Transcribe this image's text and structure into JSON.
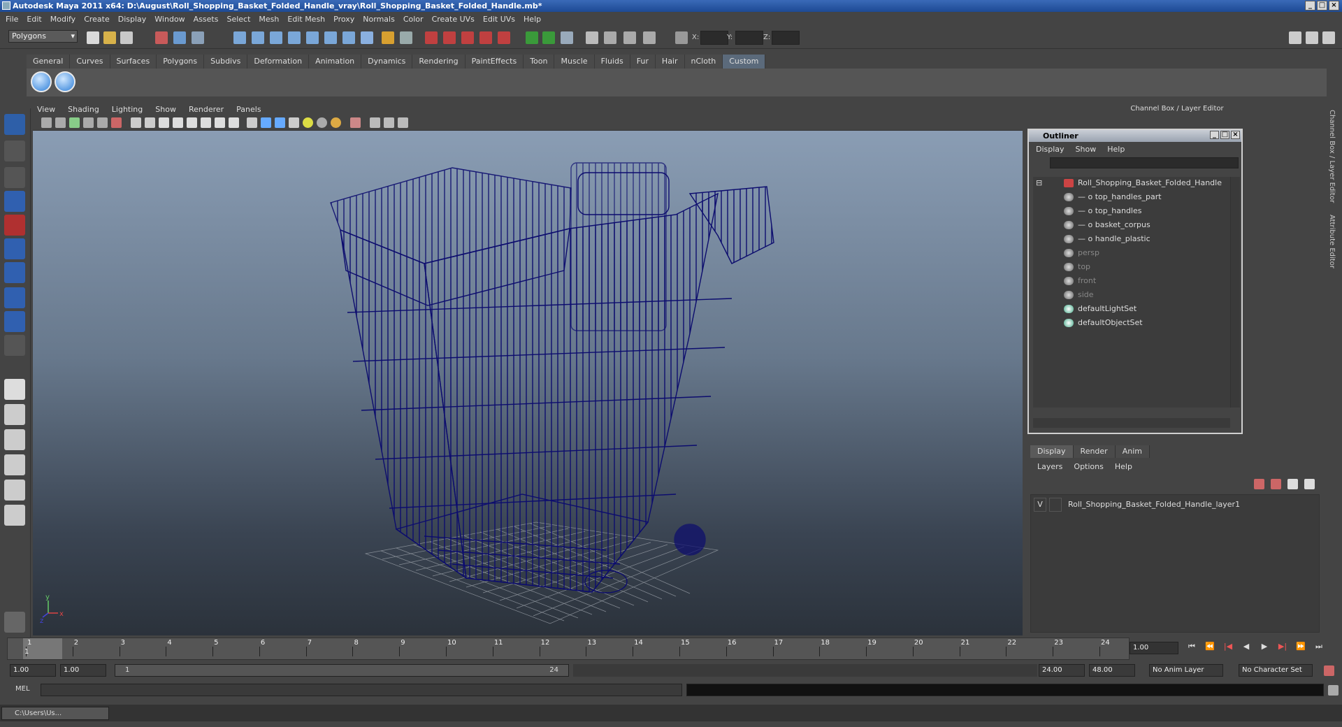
{
  "window": {
    "title": "Autodesk Maya 2011 x64: D:\\August\\Roll_Shopping_Basket_Folded_Handle_vray\\Roll_Shopping_Basket_Folded_Handle.mb*"
  },
  "menu": [
    "File",
    "Edit",
    "Modify",
    "Create",
    "Display",
    "Window",
    "Assets",
    "Select",
    "Mesh",
    "Edit Mesh",
    "Proxy",
    "Normals",
    "Color",
    "Create UVs",
    "Edit UVs",
    "Help"
  ],
  "toolbar": {
    "mode": "Polygons",
    "x_label": "X:",
    "y_label": "Y:",
    "z_label": "Z:"
  },
  "shelf_tabs": [
    "General",
    "Curves",
    "Surfaces",
    "Polygons",
    "Subdivs",
    "Deformation",
    "Animation",
    "Dynamics",
    "Rendering",
    "PaintEffects",
    "Toon",
    "Muscle",
    "Fluids",
    "Fur",
    "Hair",
    "nCloth",
    "Custom"
  ],
  "shelf_active": "Custom",
  "viewport_menu": [
    "View",
    "Shading",
    "Lighting",
    "Show",
    "Renderer",
    "Panels"
  ],
  "axis": {
    "y": "y",
    "x": "x",
    "z": "z"
  },
  "channel_box_title": "Channel Box / Layer Editor",
  "outliner": {
    "title": "Outliner",
    "menu": [
      "Display",
      "Show",
      "Help"
    ],
    "items": [
      {
        "label": "Roll_Shopping_Basket_Folded_Handle",
        "dim": false
      },
      {
        "label": "top_handles_part",
        "dim": false
      },
      {
        "label": "top_handles",
        "dim": false
      },
      {
        "label": "basket_corpus",
        "dim": false
      },
      {
        "label": "handle_plastic",
        "dim": false
      },
      {
        "label": "persp",
        "dim": true
      },
      {
        "label": "top",
        "dim": true
      },
      {
        "label": "front",
        "dim": true
      },
      {
        "label": "side",
        "dim": true
      },
      {
        "label": "defaultLightSet",
        "dim": false
      },
      {
        "label": "defaultObjectSet",
        "dim": false
      }
    ]
  },
  "layer_editor": {
    "tabs": [
      "Display",
      "Render",
      "Anim"
    ],
    "menu": [
      "Layers",
      "Options",
      "Help"
    ],
    "layer": {
      "visible": "V",
      "name": "Roll_Shopping_Basket_Folded_Handle_layer1"
    }
  },
  "side_tabs": [
    "Channel Box / Layer Editor",
    "Attribute Editor"
  ],
  "timeline": {
    "ticks": [
      "1",
      "2",
      "3",
      "4",
      "5",
      "6",
      "7",
      "8",
      "9",
      "10",
      "11",
      "12",
      "13",
      "14",
      "15",
      "16",
      "17",
      "18",
      "19",
      "20",
      "21",
      "22",
      "23",
      "24"
    ],
    "current_frame": "1.00"
  },
  "range": {
    "start": "1.00",
    "current": "1.00",
    "slider_start": "1",
    "slider_end": "24",
    "end": "24.00",
    "total_end": "48.00",
    "anim_layer": "No Anim Layer",
    "char_set": "No Character Set"
  },
  "mel": {
    "label": "MEL"
  },
  "taskbar": {
    "item": "C:\\Users\\Us..."
  },
  "colors": {
    "wireframe": "#0c0c6e",
    "accent": "#5b6a7b"
  }
}
